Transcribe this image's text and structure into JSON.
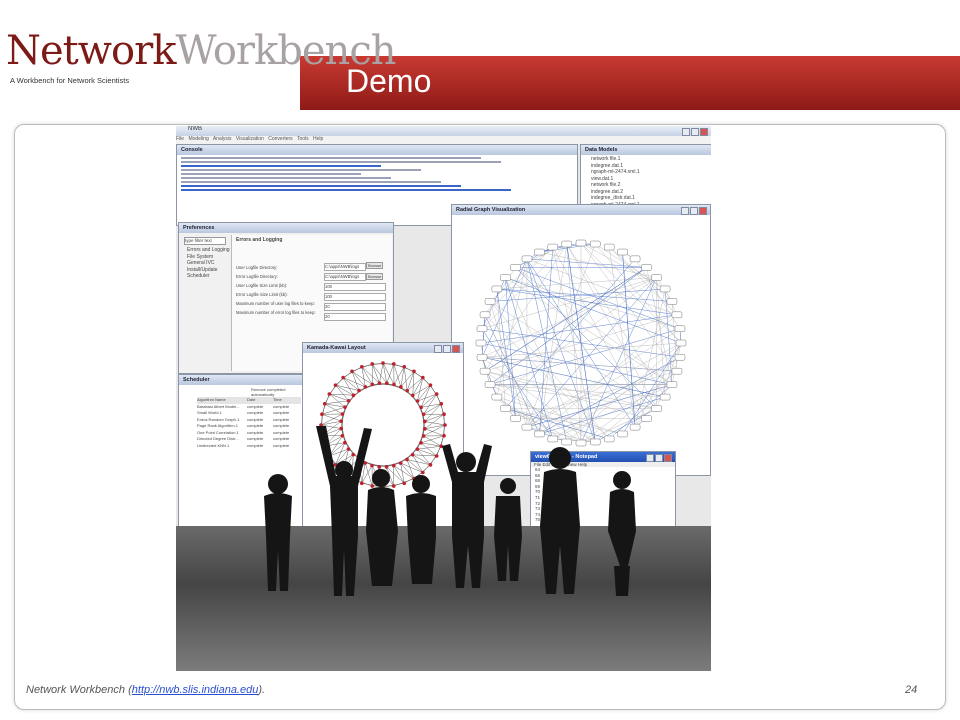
{
  "header": {
    "logo_main": "Network",
    "logo_accent": "Workbench",
    "logo_tagline": "A Workbench for Network Scientists",
    "title": "Demo"
  },
  "screenshot": {
    "app_title": "NWB",
    "menu": "File  Modeling  Analysis  Visualization  Converters  Tools  Help",
    "console_tab": "Console",
    "data_models_title": "Data Models",
    "data_models_items": [
      "network file.1",
      "indegree.dat.1",
      "ngraph-ml-2474.xml.1",
      "view.dat.1",
      "network file.2",
      "indegree.dat.2",
      "indegree_distr.dat.1",
      "ngraph-ml-2474.xml.1"
    ],
    "preferences_title": "Preferences",
    "preferences_filter": "type filter text",
    "preferences_tree": [
      "Errors and Logging",
      "File System",
      "General IVC",
      "Install/Update",
      "Scheduler"
    ],
    "errors_logging_title": "Errors and Logging",
    "pref_fields": [
      "User Logfile Directory:",
      "Error Logfile Directory:",
      "User Logfile Size Limit (kb):",
      "Error Logfile Size Limit (kb):",
      "Maximum number of user log files to keep:",
      "Maximum number of error log files to keep:"
    ],
    "pref_values": [
      "C:\\apps\\NWB\\logs",
      "C:\\apps\\NWB\\logs",
      "100",
      "100",
      "20",
      "20"
    ],
    "browse_label": "Browse",
    "scheduler_title": "Scheduler",
    "scheduler_remove_label": "Remove completed automatically",
    "scheduler_columns": [
      "Algorithm Name",
      "Date",
      "Time"
    ],
    "scheduler_rows": [
      [
        "Barabasi Albert Model...",
        "complete",
        "complete"
      ],
      [
        "Small World.1",
        "complete",
        "complete"
      ],
      [
        "Erdos Random Graph.1",
        "complete",
        "complete"
      ],
      [
        "Page Rank Algorithm.1",
        "complete",
        "complete"
      ],
      [
        "One Point Correlation.1",
        "complete",
        "complete"
      ],
      [
        "Directed Degree Distr...",
        "complete",
        "complete"
      ],
      [
        "Undirected KNN.1",
        "complete",
        "complete"
      ]
    ],
    "radial_title": "Radial Graph Visualization",
    "kk_title": "Kamada-Kawai Layout",
    "notepad_title": "view61360.txt - Notepad",
    "notepad_menu": "File  Edit  Format  View  Help",
    "notepad_lines": [
      "64",
      "66",
      "68",
      "69",
      "70",
      "71",
      "72",
      "73",
      "74",
      "75"
    ]
  },
  "footer": {
    "text_before": "Network Workbench (",
    "link": "http://nwb.slis.indiana.edu",
    "text_after": ").",
    "page_number": "24"
  },
  "colors": {
    "banner_red": "#a82622",
    "accent_blue": "#3a66c8",
    "node_red": "#c0202a"
  }
}
